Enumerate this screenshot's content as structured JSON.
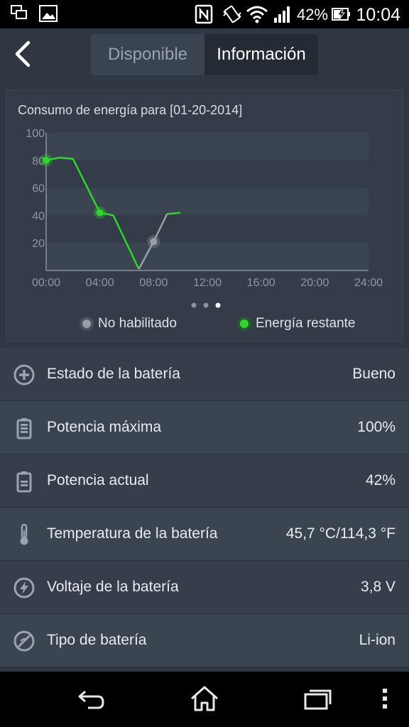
{
  "status_bar": {
    "icons": [
      "screen-cast-icon",
      "image-icon",
      "nfc-icon",
      "vibrate-icon",
      "wifi-icon",
      "signal-icon",
      "battery-charging-icon"
    ],
    "battery_percent": "42%",
    "time": "10:04"
  },
  "topbar": {
    "back_icon": "chevron-left-icon",
    "tabs": [
      {
        "label": "Disponible",
        "active": false
      },
      {
        "label": "Información",
        "active": true
      }
    ]
  },
  "chart": {
    "title": "Consumo de energía para [01-20-2014]",
    "page_dots": 3,
    "active_dot": 2,
    "legend": [
      {
        "label": "No habilitado",
        "color": "#9a9fa6"
      },
      {
        "label": "Energía restante",
        "color": "#2fd42f"
      }
    ]
  },
  "chart_data": {
    "type": "line",
    "title": "Consumo de energía para [01-20-2014]",
    "xlabel": "",
    "ylabel": "",
    "x_ticks": [
      "00:00",
      "04:00",
      "08:00",
      "12:00",
      "16:00",
      "20:00",
      "24:00"
    ],
    "y_ticks": [
      20,
      40,
      60,
      80,
      100
    ],
    "xlim": [
      0,
      24
    ],
    "ylim": [
      0,
      100
    ],
    "grid": true,
    "legend_position": "bottom",
    "series": [
      {
        "name": "Energía restante",
        "color": "#2fd42f",
        "points": [
          [
            0,
            80
          ],
          [
            1,
            82
          ],
          [
            2,
            81
          ],
          [
            4,
            42
          ],
          [
            5,
            40
          ],
          [
            6.9,
            1
          ]
        ],
        "markers": [
          [
            0,
            80
          ],
          [
            4,
            42
          ]
        ]
      },
      {
        "name": "No habilitado",
        "color": "#9a9fa6",
        "points": [
          [
            6.9,
            1
          ],
          [
            8,
            21
          ],
          [
            9,
            41
          ]
        ],
        "markers": [
          [
            8,
            21
          ]
        ]
      },
      {
        "name": "Energía restante",
        "color": "#2fd42f",
        "points": [
          [
            9,
            41
          ],
          [
            10,
            42
          ]
        ],
        "markers": []
      }
    ]
  },
  "info": [
    {
      "icon": "plus-circle-icon",
      "label": "Estado de la batería",
      "value": "Bueno"
    },
    {
      "icon": "battery-full-icon",
      "label": "Potencia máxima",
      "value": "100%"
    },
    {
      "icon": "battery-half-icon",
      "label": "Potencia actual",
      "value": "42%"
    },
    {
      "icon": "thermometer-icon",
      "label": "Temperatura de la batería",
      "value": "45,7 °C/114,3 °F"
    },
    {
      "icon": "lightning-circle-icon",
      "label": "Voltaje de la batería",
      "value": "3,8 V"
    },
    {
      "icon": "battery-type-icon",
      "label": "Tipo de batería",
      "value": "Li-ion"
    }
  ],
  "nav": {
    "buttons": [
      "back-icon",
      "home-icon",
      "recents-icon",
      "menu-icon"
    ]
  }
}
